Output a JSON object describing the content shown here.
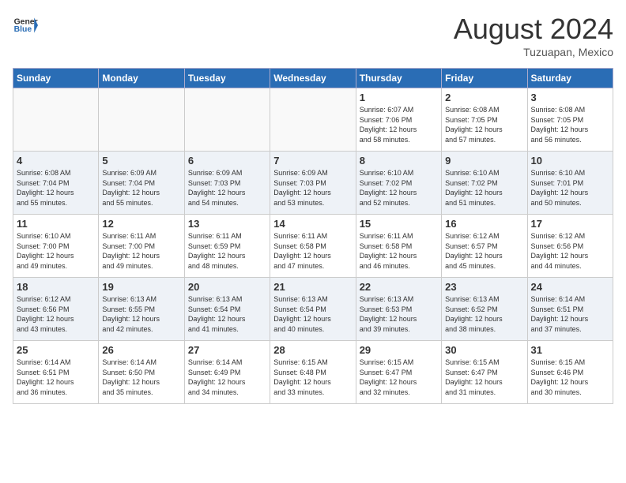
{
  "header": {
    "logo_general": "General",
    "logo_blue": "Blue",
    "month_year": "August 2024",
    "location": "Tuzuapan, Mexico"
  },
  "weekdays": [
    "Sunday",
    "Monday",
    "Tuesday",
    "Wednesday",
    "Thursday",
    "Friday",
    "Saturday"
  ],
  "weeks": [
    [
      {
        "day": "",
        "detail": "",
        "empty": true
      },
      {
        "day": "",
        "detail": "",
        "empty": true
      },
      {
        "day": "",
        "detail": "",
        "empty": true
      },
      {
        "day": "",
        "detail": "",
        "empty": true
      },
      {
        "day": "1",
        "detail": "Sunrise: 6:07 AM\nSunset: 7:06 PM\nDaylight: 12 hours\nand 58 minutes."
      },
      {
        "day": "2",
        "detail": "Sunrise: 6:08 AM\nSunset: 7:05 PM\nDaylight: 12 hours\nand 57 minutes."
      },
      {
        "day": "3",
        "detail": "Sunrise: 6:08 AM\nSunset: 7:05 PM\nDaylight: 12 hours\nand 56 minutes."
      }
    ],
    [
      {
        "day": "4",
        "detail": "Sunrise: 6:08 AM\nSunset: 7:04 PM\nDaylight: 12 hours\nand 55 minutes."
      },
      {
        "day": "5",
        "detail": "Sunrise: 6:09 AM\nSunset: 7:04 PM\nDaylight: 12 hours\nand 55 minutes."
      },
      {
        "day": "6",
        "detail": "Sunrise: 6:09 AM\nSunset: 7:03 PM\nDaylight: 12 hours\nand 54 minutes."
      },
      {
        "day": "7",
        "detail": "Sunrise: 6:09 AM\nSunset: 7:03 PM\nDaylight: 12 hours\nand 53 minutes."
      },
      {
        "day": "8",
        "detail": "Sunrise: 6:10 AM\nSunset: 7:02 PM\nDaylight: 12 hours\nand 52 minutes."
      },
      {
        "day": "9",
        "detail": "Sunrise: 6:10 AM\nSunset: 7:02 PM\nDaylight: 12 hours\nand 51 minutes."
      },
      {
        "day": "10",
        "detail": "Sunrise: 6:10 AM\nSunset: 7:01 PM\nDaylight: 12 hours\nand 50 minutes."
      }
    ],
    [
      {
        "day": "11",
        "detail": "Sunrise: 6:10 AM\nSunset: 7:00 PM\nDaylight: 12 hours\nand 49 minutes."
      },
      {
        "day": "12",
        "detail": "Sunrise: 6:11 AM\nSunset: 7:00 PM\nDaylight: 12 hours\nand 49 minutes."
      },
      {
        "day": "13",
        "detail": "Sunrise: 6:11 AM\nSunset: 6:59 PM\nDaylight: 12 hours\nand 48 minutes."
      },
      {
        "day": "14",
        "detail": "Sunrise: 6:11 AM\nSunset: 6:58 PM\nDaylight: 12 hours\nand 47 minutes."
      },
      {
        "day": "15",
        "detail": "Sunrise: 6:11 AM\nSunset: 6:58 PM\nDaylight: 12 hours\nand 46 minutes."
      },
      {
        "day": "16",
        "detail": "Sunrise: 6:12 AM\nSunset: 6:57 PM\nDaylight: 12 hours\nand 45 minutes."
      },
      {
        "day": "17",
        "detail": "Sunrise: 6:12 AM\nSunset: 6:56 PM\nDaylight: 12 hours\nand 44 minutes."
      }
    ],
    [
      {
        "day": "18",
        "detail": "Sunrise: 6:12 AM\nSunset: 6:56 PM\nDaylight: 12 hours\nand 43 minutes."
      },
      {
        "day": "19",
        "detail": "Sunrise: 6:13 AM\nSunset: 6:55 PM\nDaylight: 12 hours\nand 42 minutes."
      },
      {
        "day": "20",
        "detail": "Sunrise: 6:13 AM\nSunset: 6:54 PM\nDaylight: 12 hours\nand 41 minutes."
      },
      {
        "day": "21",
        "detail": "Sunrise: 6:13 AM\nSunset: 6:54 PM\nDaylight: 12 hours\nand 40 minutes."
      },
      {
        "day": "22",
        "detail": "Sunrise: 6:13 AM\nSunset: 6:53 PM\nDaylight: 12 hours\nand 39 minutes."
      },
      {
        "day": "23",
        "detail": "Sunrise: 6:13 AM\nSunset: 6:52 PM\nDaylight: 12 hours\nand 38 minutes."
      },
      {
        "day": "24",
        "detail": "Sunrise: 6:14 AM\nSunset: 6:51 PM\nDaylight: 12 hours\nand 37 minutes."
      }
    ],
    [
      {
        "day": "25",
        "detail": "Sunrise: 6:14 AM\nSunset: 6:51 PM\nDaylight: 12 hours\nand 36 minutes."
      },
      {
        "day": "26",
        "detail": "Sunrise: 6:14 AM\nSunset: 6:50 PM\nDaylight: 12 hours\nand 35 minutes."
      },
      {
        "day": "27",
        "detail": "Sunrise: 6:14 AM\nSunset: 6:49 PM\nDaylight: 12 hours\nand 34 minutes."
      },
      {
        "day": "28",
        "detail": "Sunrise: 6:15 AM\nSunset: 6:48 PM\nDaylight: 12 hours\nand 33 minutes."
      },
      {
        "day": "29",
        "detail": "Sunrise: 6:15 AM\nSunset: 6:47 PM\nDaylight: 12 hours\nand 32 minutes."
      },
      {
        "day": "30",
        "detail": "Sunrise: 6:15 AM\nSunset: 6:47 PM\nDaylight: 12 hours\nand 31 minutes."
      },
      {
        "day": "31",
        "detail": "Sunrise: 6:15 AM\nSunset: 6:46 PM\nDaylight: 12 hours\nand 30 minutes."
      }
    ]
  ]
}
